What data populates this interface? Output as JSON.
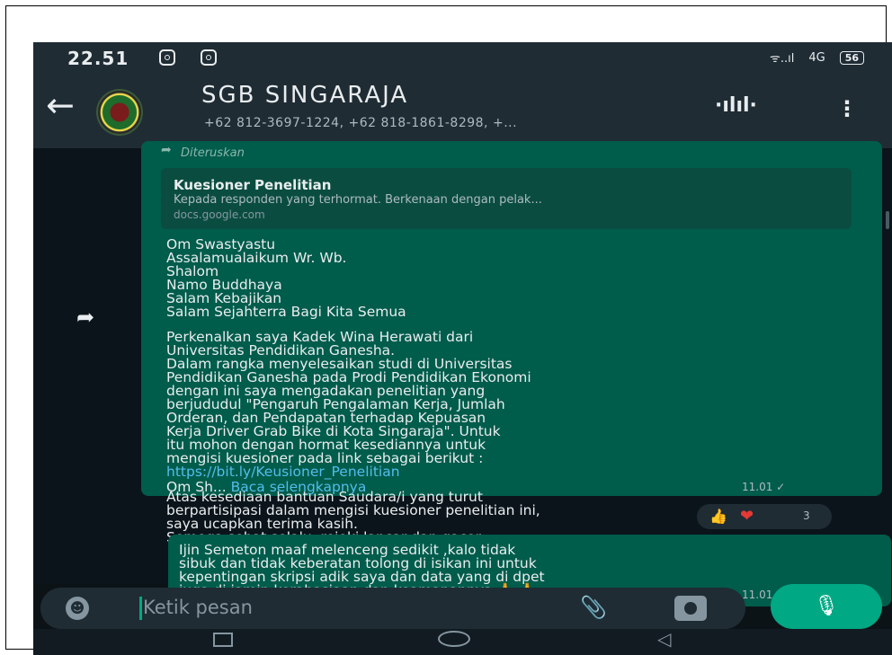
{
  "status_bar": {
    "time": "22.51",
    "signal": "ᯤ..ıl",
    "network": "4G",
    "battery": "56"
  },
  "header": {
    "title": "SGB SINGARAJA",
    "subtitle": "+62 812-3697-1224, +62 818-1861-8298, +...",
    "voice_icon": "·ılıl·",
    "menu_icon": "⋮"
  },
  "message1": {
    "forwarded_label": "Diteruskan",
    "preview": {
      "title": "Kuesioner Penelitian",
      "description": "Kepada responden yang terhormat. Berkenaan dengan pelak...",
      "domain": "docs.google.com"
    },
    "greeting_lines": [
      "Om Swastyastu",
      "Assalamualaikum Wr. Wb.",
      "Shalom",
      "Namo Buddhaya",
      "Salam Kebajikan",
      "Salam Sejahterra Bagi Kita Semua"
    ],
    "intro_lines": [
      "Perkenalkan saya Kadek Wina Herawati dari",
      "Universitas Pendidikan Ganesha.",
      "Dalam rangka menyelesaikan studi di Universitas",
      "Pendidikan Ganesha pada Prodi Pendidikan Ekonomi",
      "dengan ini saya mengadakan penelitian yang",
      "berjududul \"Pengaruh Pengalaman Kerja, Jumlah",
      "Orderan, dan Pendapatan terhadap Kepuasan",
      "Kerja Driver Grab Bike di Kota Singaraja\". Untuk",
      "itu mohon dengan hormat kesediannya untuk",
      "mengisi kuesioner pada link sebagai berikut :"
    ],
    "link": "https://bit.ly/Keusioner_Penelitian",
    "closing_lines": [
      "Atas kesediaan bantuan Saudara/i yang turut",
      "berpartisipasi dalam mengisi kuesioner penelitian ini,",
      "saya ucapkan terima kasih.",
      "Semoga sehat selalu, rejeki lancar dan gacor...."
    ],
    "truncated_text": "Om Sh...",
    "read_more": "Baca selengkapnya",
    "time": "11.01",
    "reactions": {
      "like": "👍",
      "heart": "❤",
      "count": "3"
    }
  },
  "message2": {
    "lines": [
      "Ijin Semeton maaf melenceng sedikit ,kalo tidak",
      "sibuk dan tidak keberatan tolong di isikan ini untuk",
      "kepentingan skripsi adik saya dan data yang di dpet",
      "juga di jamin kerahasiaan dan keamanannya 🙏 🙏",
      "🙏"
    ],
    "time": "11.01"
  },
  "input": {
    "placeholder": "Ketik pesan"
  },
  "icons": {
    "back": "arrow-left-icon",
    "share": "forward-share-icon",
    "emoji": "emoji-icon",
    "attach": "paperclip-icon",
    "camera": "camera-icon",
    "mic": "mic-icon"
  },
  "colors": {
    "outgoing_bubble": "#005c4b",
    "accent": "#00a884",
    "link": "#53bdeb",
    "background": "#0b141a"
  }
}
